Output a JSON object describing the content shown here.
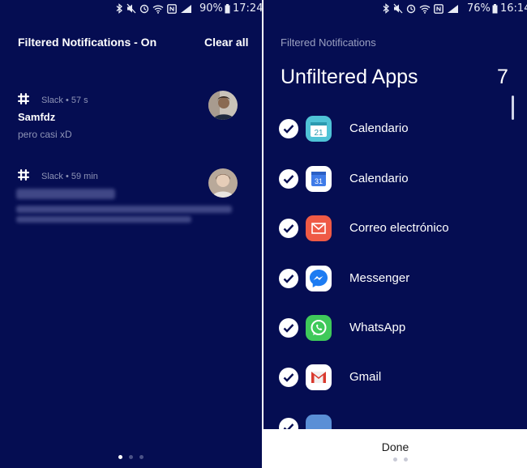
{
  "left": {
    "status": {
      "battery": "90%",
      "time": "17:24"
    },
    "header": {
      "title": "Filtered Notifications - On",
      "clear_all": "Clear all"
    },
    "notifications": [
      {
        "app": "Slack",
        "time_ago": "57 s",
        "sender": "Samfdz",
        "body": "pero casi xD",
        "icon": "slack-icon"
      },
      {
        "app": "Slack",
        "time_ago": "59 min",
        "sender": "",
        "body": "",
        "icon": "slack-icon",
        "blurred": true
      }
    ],
    "separator": "•",
    "pager": {
      "pages": 3,
      "current": 1
    }
  },
  "right": {
    "status": {
      "battery": "76%",
      "time": "16:14"
    },
    "header": {
      "subtitle": "Filtered Notifications",
      "title": "Unfiltered Apps",
      "count": "7"
    },
    "apps": [
      {
        "name": "Calendario",
        "icon": "calendar-icon",
        "checked": true
      },
      {
        "name": "Calendario",
        "icon": "google-calendar-icon",
        "checked": true
      },
      {
        "name": "Correo electrónico",
        "icon": "email-icon",
        "checked": true
      },
      {
        "name": "Messenger",
        "icon": "messenger-icon",
        "checked": true
      },
      {
        "name": "WhatsApp",
        "icon": "whatsapp-icon",
        "checked": true
      },
      {
        "name": "Gmail",
        "icon": "gmail-icon",
        "checked": true
      }
    ],
    "done_label": "Done",
    "colors": {
      "background": "#050d52",
      "panel": "#ffffff"
    }
  }
}
